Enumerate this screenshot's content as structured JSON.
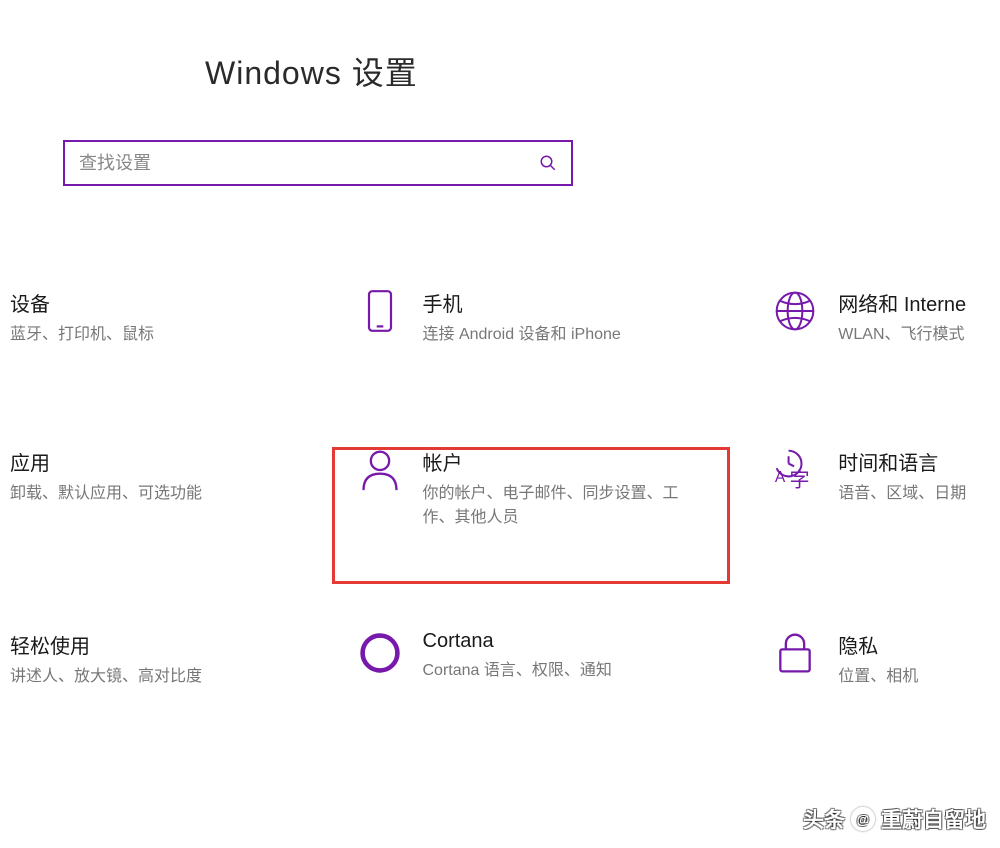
{
  "title": "Windows 设置",
  "search": {
    "placeholder": "查找设置"
  },
  "accent_color": "#7719aa",
  "highlight_color": "#e53935",
  "categories": [
    [
      {
        "title": "设备",
        "desc": "蓝牙、打印机、鼠标"
      },
      {
        "title": "手机",
        "desc": "连接 Android 设备和 iPhone"
      },
      {
        "title": "网络和 Interne",
        "desc": "WLAN、飞行模式"
      }
    ],
    [
      {
        "title": "应用",
        "desc": "卸载、默认应用、可选功能"
      },
      {
        "title": "帐户",
        "desc": "你的帐户、电子邮件、同步设置、工作、其他人员"
      },
      {
        "title": "时间和语言",
        "desc": "语音、区域、日期"
      }
    ],
    [
      {
        "title": "轻松使用",
        "desc": "讲述人、放大镜、高对比度"
      },
      {
        "title": "Cortana",
        "desc": "Cortana 语言、权限、通知"
      },
      {
        "title": "隐私",
        "desc": "位置、相机"
      }
    ]
  ],
  "watermark": {
    "prefix": "头条",
    "text": "重蔚自留地"
  }
}
